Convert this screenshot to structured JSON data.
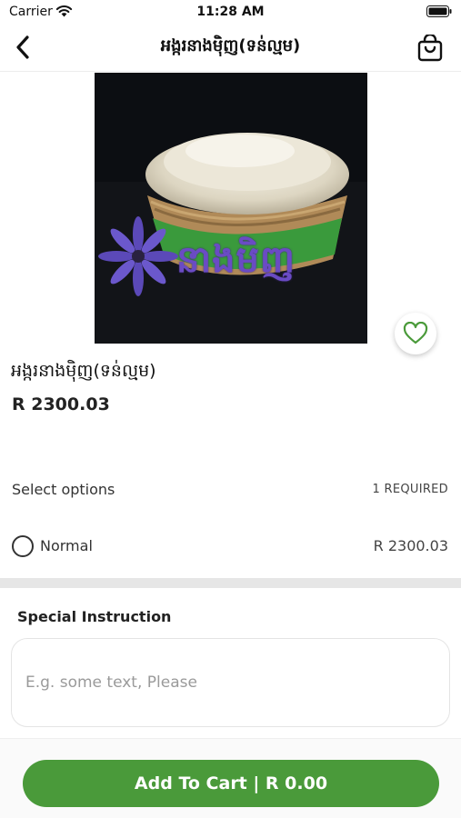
{
  "status_bar": {
    "carrier": "Carrier",
    "time": "11:28 AM",
    "icons": [
      "wifi-icon",
      "battery-icon"
    ]
  },
  "nav": {
    "title": "អង្ករនាងម៉ិញ(ទន់ល្មម)",
    "back_icon": "chevron-left-icon",
    "cart_icon": "shopping-bag-icon"
  },
  "product": {
    "image_watermark": "នាងមិញ",
    "name": "អង្ករនាងម៉ិញ(ទន់ល្មម)",
    "price": "R 2300.03",
    "favorite_icon": "heart-icon"
  },
  "options": {
    "label": "Select options",
    "required": "1 REQUIRED",
    "items": [
      {
        "name": "Normal",
        "price": "R 2300.03",
        "selected": false
      }
    ]
  },
  "instruction": {
    "label": "Special Instruction",
    "placeholder": "E.g. some text, Please",
    "value": ""
  },
  "cart_button": {
    "label": "Add To Cart | R 0.00"
  },
  "colors": {
    "accent": "#4a9a3a",
    "separator": "#e6e6e6"
  }
}
